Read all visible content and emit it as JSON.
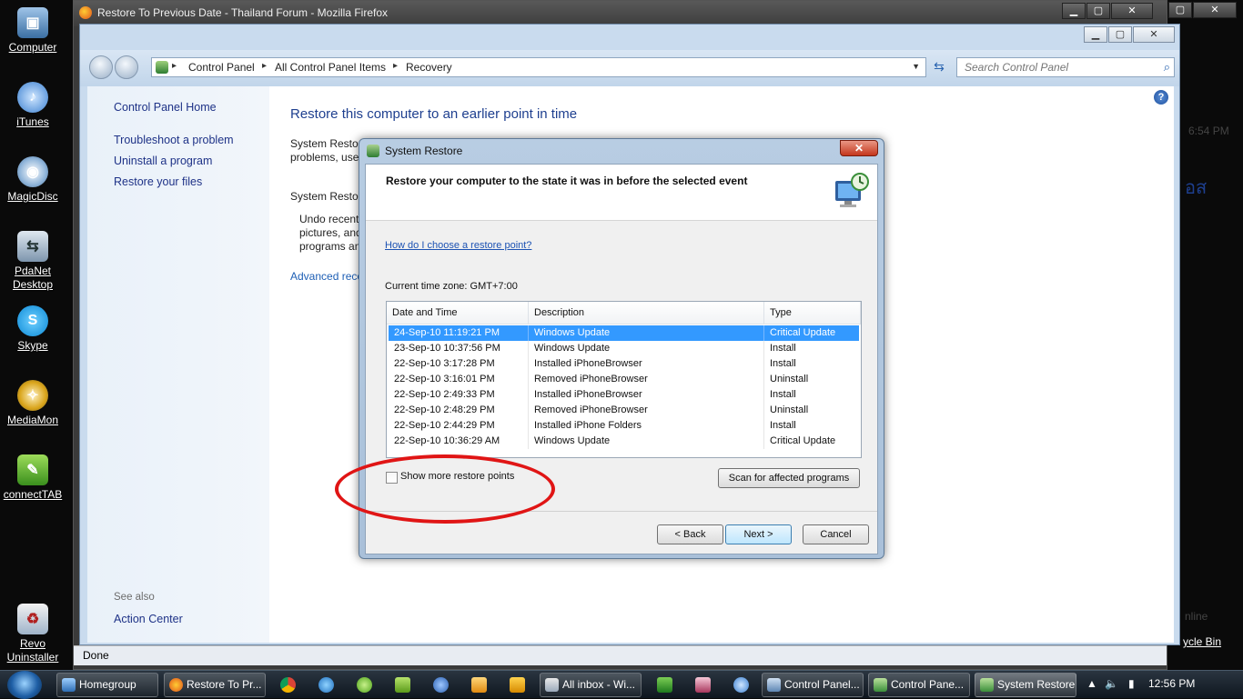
{
  "desktop": {
    "icons": [
      {
        "label": "Computer"
      },
      {
        "label": "iTunes"
      },
      {
        "label": "MagicDisc"
      },
      {
        "label": "PdaNet Desktop"
      },
      {
        "label": "Skype"
      },
      {
        "label": "MediaMon"
      },
      {
        "label": "connectTAB"
      },
      {
        "label": "Revo Uninstaller"
      }
    ]
  },
  "firefox": {
    "title": "Restore To Previous Date - Thailand Forum - Mozilla Firefox",
    "status": "Done",
    "edge_time": "6:54 PM",
    "edge_thai": "อส",
    "edge_online": "nline",
    "edge_recycle": "ycle Bin"
  },
  "control_panel": {
    "breadcrumb": [
      "Control Panel",
      "All Control Panel Items",
      "Recovery"
    ],
    "search_placeholder": "Search Control Panel",
    "sidebar": {
      "home": "Control Panel Home",
      "links": [
        "Troubleshoot a problem",
        "Uninstall a program",
        "Restore your files"
      ],
      "see_also": "See also",
      "action_center": "Action Center"
    },
    "main": {
      "title": "Restore this computer to an earlier point in time",
      "para1_line1": "System Restor",
      "para1_line2": "problems, use",
      "section": "System Restor",
      "para2_line1": "Undo recent",
      "para2_line2": "pictures, and",
      "para2_line3": "programs an",
      "advanced_link": "Advanced reco"
    }
  },
  "system_restore": {
    "title": "System Restore",
    "heading": "Restore your computer to the state it was in before the selected event",
    "help_link": "How do I choose a restore point?",
    "timezone": "Current time zone: GMT+7:00",
    "columns": [
      "Date and Time",
      "Description",
      "Type"
    ],
    "rows": [
      {
        "date": "24-Sep-10 11:19:21 PM",
        "description": "Windows Update",
        "type": "Critical Update",
        "selected": true
      },
      {
        "date": "23-Sep-10 10:37:56 PM",
        "description": "Windows Update",
        "type": "Install"
      },
      {
        "date": "22-Sep-10 3:17:28 PM",
        "description": "Installed iPhoneBrowser",
        "type": "Install"
      },
      {
        "date": "22-Sep-10 3:16:01 PM",
        "description": "Removed iPhoneBrowser",
        "type": "Uninstall"
      },
      {
        "date": "22-Sep-10 2:49:33 PM",
        "description": "Installed iPhoneBrowser",
        "type": "Install"
      },
      {
        "date": "22-Sep-10 2:48:29 PM",
        "description": "Removed iPhoneBrowser",
        "type": "Uninstall"
      },
      {
        "date": "22-Sep-10 2:44:29 PM",
        "description": "Installed iPhone Folders",
        "type": "Install"
      },
      {
        "date": "22-Sep-10 10:36:29 AM",
        "description": "Windows Update",
        "type": "Critical Update"
      }
    ],
    "show_more_label": "Show more restore points",
    "show_more_checked": false,
    "scan_button": "Scan for affected programs",
    "back_button": "< Back",
    "next_button": "Next >",
    "cancel_button": "Cancel",
    "highlight_color": "#e01515"
  },
  "taskbar": {
    "tasks": [
      {
        "label": "Homegroup"
      },
      {
        "label": "Restore To Pr..."
      },
      {
        "label": "All inbox - Wi..."
      },
      {
        "label": "Control Panel..."
      },
      {
        "label": "Control Pane..."
      },
      {
        "label": "System Restore"
      }
    ],
    "clock": "12:56 PM"
  }
}
